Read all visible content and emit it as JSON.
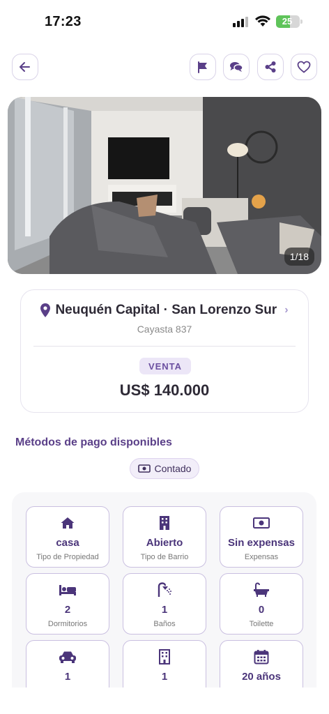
{
  "status_bar": {
    "time": "17:23",
    "battery": "25"
  },
  "photo": {
    "counter": "1/18"
  },
  "location": {
    "title": "Neuquén Capital · San Lorenzo Sur",
    "address": "Cayasta 837",
    "operation": "VENTA",
    "price": "US$ 140.000"
  },
  "payment": {
    "title": "Métodos de pago disponibles",
    "methods": [
      "Contado"
    ]
  },
  "features": [
    {
      "icon": "house-icon",
      "value": "casa",
      "label": "Tipo de Propiedad"
    },
    {
      "icon": "building-icon",
      "value": "Abierto",
      "label": "Tipo de Barrio"
    },
    {
      "icon": "banknote-icon",
      "value": "Sin expensas",
      "label": "Expensas"
    },
    {
      "icon": "bed-icon",
      "value": "2",
      "label": "Dormitorios"
    },
    {
      "icon": "shower-icon",
      "value": "1",
      "label": "Baños"
    },
    {
      "icon": "bathtub-icon",
      "value": "0",
      "label": "Toilette"
    },
    {
      "icon": "car-icon",
      "value": "1",
      "label": ""
    },
    {
      "icon": "building-icon",
      "value": "1",
      "label": ""
    },
    {
      "icon": "calendar-icon",
      "value": "20 años",
      "label": ""
    }
  ],
  "colors": {
    "accent": "#5a3f88",
    "accent_light": "#ece6f7",
    "border": "#c9bfe0"
  }
}
